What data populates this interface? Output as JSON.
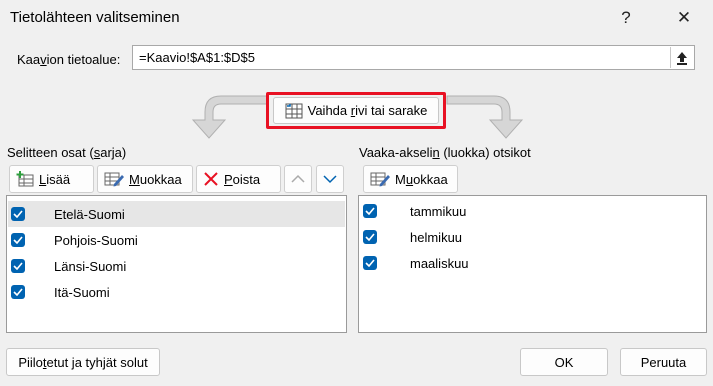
{
  "window": {
    "title": "Tietolähteen valitseminen",
    "help_label": "?",
    "close_label": "✕"
  },
  "range": {
    "label_pre": "Kaa",
    "label_key": "v",
    "label_post": "ion tietoalue:",
    "value": "=Kaavio!$A$1:$D$5"
  },
  "switch_button": {
    "pre": "Vaihda ",
    "key": "r",
    "post": "ivi tai sarake"
  },
  "series_panel": {
    "label_pre": "Selitteen osat (",
    "label_key": "s",
    "label_post": "arja)",
    "add": {
      "pre": "",
      "key": "L",
      "post": "isää"
    },
    "edit": {
      "pre": "",
      "key": "M",
      "post": "uokkaa"
    },
    "remove": {
      "pre": "",
      "key": "P",
      "post": "oista"
    },
    "items": [
      {
        "label": "Etelä-Suomi",
        "checked": true,
        "selected": true
      },
      {
        "label": "Pohjois-Suomi",
        "checked": true
      },
      {
        "label": "Länsi-Suomi",
        "checked": true
      },
      {
        "label": "Itä-Suomi",
        "checked": true
      }
    ]
  },
  "category_panel": {
    "label_pre": "Vaaka-akseli",
    "label_key": "n",
    "label_post": " (luokka) otsikot",
    "edit": {
      "pre": "M",
      "key": "u",
      "post": "okkaa"
    },
    "items": [
      {
        "label": "tammikuu",
        "checked": true
      },
      {
        "label": "helmikuu",
        "checked": true
      },
      {
        "label": "maaliskuu",
        "checked": true
      }
    ]
  },
  "footer": {
    "hidden_cells": {
      "pre": "Piilo",
      "key": "t",
      "post": "etut ja tyhjät solut"
    },
    "ok_label": "OK",
    "cancel_label": "Peruuta"
  },
  "colors": {
    "accent": "#0063b1",
    "highlight": "#e81123",
    "selected_row": "#e6e6e6"
  }
}
